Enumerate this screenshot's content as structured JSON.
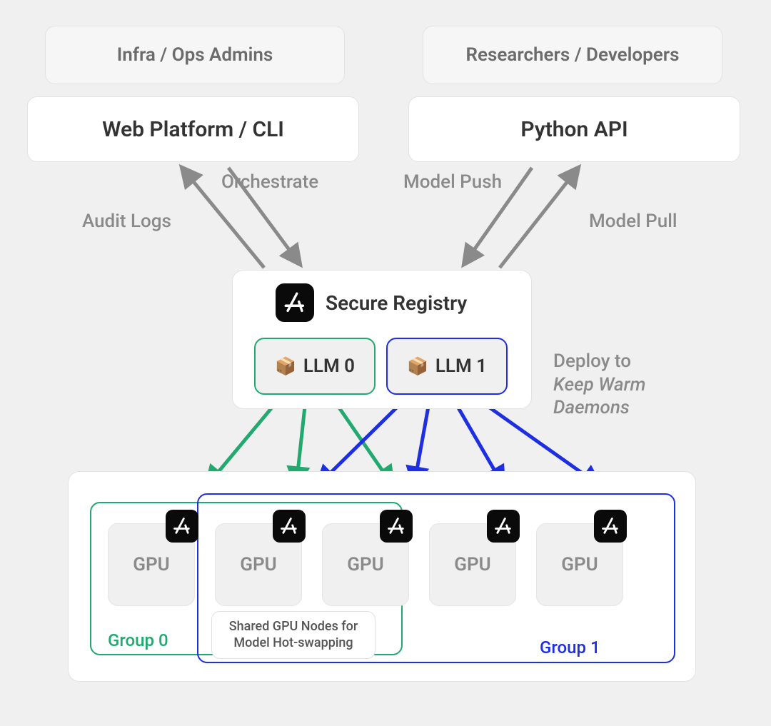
{
  "roles": {
    "admins": "Infra / Ops Admins",
    "devs": "Researchers / Developers"
  },
  "interfaces": {
    "web_cli": "Web Platform / CLI",
    "python_api": "Python API"
  },
  "registry": {
    "title": "Secure Registry",
    "llm0": "LLM 0",
    "llm1": "LLM 1"
  },
  "edges": {
    "audit_logs": "Audit Logs",
    "orchestrate": "Orchestrate",
    "model_push": "Model Push",
    "model_pull": "Model Pull"
  },
  "deploy": {
    "line1": "Deploy to",
    "line2": "Keep Warm",
    "line3": "Daemons"
  },
  "gpu": {
    "label": "GPU",
    "group0": "Group 0",
    "group1": "Group 1",
    "shared_l1": "Shared GPU Nodes for",
    "shared_l2": "Model Hot-swapping"
  },
  "colors": {
    "green": "#22a96f",
    "blue": "#1d2fe0",
    "grey": "#8a8a8a"
  }
}
